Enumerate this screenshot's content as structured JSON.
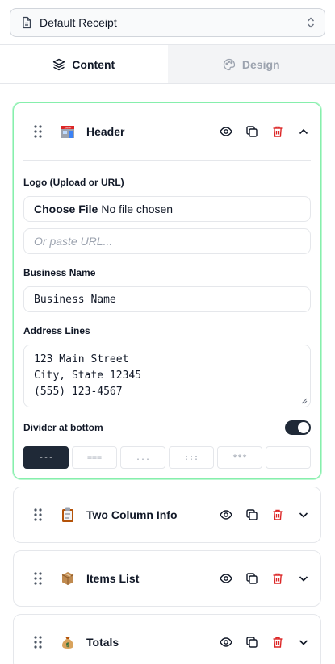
{
  "template_select": {
    "value": "Default Receipt",
    "icon": "document-icon"
  },
  "tabs": [
    {
      "label": "Content",
      "icon": "layers-icon",
      "active": true
    },
    {
      "label": "Design",
      "icon": "palette-icon",
      "active": false
    }
  ],
  "sections": [
    {
      "title": "Header",
      "emoji": "store-emoji",
      "expanded": true,
      "fields": {
        "logo_label": "Logo (Upload or URL)",
        "file_button": "Choose File",
        "file_status": "No file chosen",
        "url_placeholder": "Or paste URL...",
        "business_label": "Business Name",
        "business_value": "Business Name",
        "address_label": "Address Lines",
        "address_lines": [
          "123 Main Street",
          "City, State 12345",
          "(555) 123-4567"
        ],
        "divider_label": "Divider at bottom",
        "divider_enabled": true,
        "divider_styles": [
          "---",
          "===",
          "...",
          ":::",
          "***",
          ""
        ],
        "divider_selected": "---"
      }
    },
    {
      "title": "Two Column Info",
      "emoji": "clipboard-emoji",
      "expanded": false
    },
    {
      "title": "Items List",
      "emoji": "package-emoji",
      "expanded": false
    },
    {
      "title": "Totals",
      "emoji": "money-bag-emoji",
      "expanded": false
    }
  ],
  "colors": {
    "accent_border": "#86efac",
    "danger": "#dc2626",
    "toggle_on": "#1f2937"
  }
}
